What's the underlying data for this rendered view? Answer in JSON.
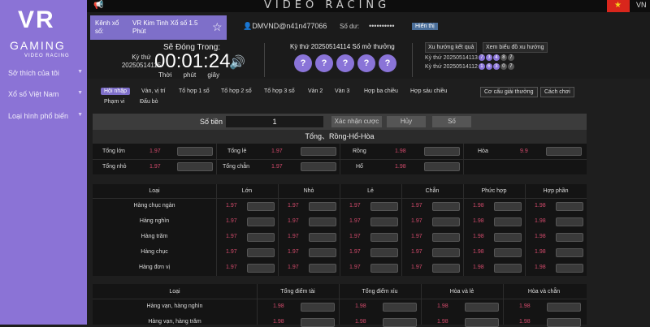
{
  "sidebar": {
    "logo_top": "VR",
    "logo_main": "GAMING",
    "logo_sub": "VIDEO RACING",
    "items": [
      {
        "label": "Sở thích của tôi"
      },
      {
        "label": "Xổ số Việt Nam"
      },
      {
        "label": "Loại hình phổ biến"
      }
    ]
  },
  "topbar": {
    "title": "VIDEO RACING",
    "lang": "VN"
  },
  "header": {
    "kenh_label": "Kênh xổ số:",
    "kenh_value": "VR Kim Tinh Xổ số 1.5 Phút",
    "user": "DMVND@n41n477066",
    "sodu_label": "Số dư:",
    "sodu_value": "••••••••••",
    "hien_thi": "Hiển thị",
    "countdown_title": "Sẽ Đóng Trong:",
    "ky_thu_label": "Kỳ thứ",
    "ky_thu_value": "20250514115",
    "timer": "00:01:24",
    "time_labels": [
      "Thời",
      "phút",
      "giây"
    ],
    "draw_label": "Kỳ thứ 20250514114  Số mở thưởng",
    "balls": [
      "?",
      "?",
      "?",
      "?",
      "?"
    ],
    "btn_trend": "Xu hướng kết quả",
    "btn_chart": "Xem biểu đồ xu hướng",
    "history": [
      {
        "label": "Kỳ thứ 20250514113",
        "nums": [
          "7",
          "3",
          "4",
          "8",
          "7"
        ]
      },
      {
        "label": "Kỳ thứ 20250514112",
        "nums": [
          "1",
          "6",
          "3",
          "0",
          "7"
        ]
      }
    ]
  },
  "tabs": [
    {
      "label": "Hội nhập",
      "active": true
    },
    {
      "label": "Vàn, vị trí"
    },
    {
      "label": "Tổ hợp 1 số"
    },
    {
      "label": "Tổ hợp 2 số"
    },
    {
      "label": "Tổ hợp 3 số"
    },
    {
      "label": "Vàn 2"
    },
    {
      "label": "Vàn 3"
    },
    {
      "label": "Hợp ba chiều"
    },
    {
      "label": "Hợp sáu chiều"
    },
    {
      "label": "Phạm vi"
    },
    {
      "label": "Đấu bò"
    }
  ],
  "tab_right": {
    "structure": "Cơ cấu giải thưởng",
    "howto": "Cách chơi"
  },
  "bet_bar": {
    "amount_label": "Số tiền",
    "amount": "1",
    "confirm": "Xác nhận cược",
    "cancel": "Hủy",
    "count": "Số"
  },
  "section_title": "Tổng、Rồng-Hổ-Hòa",
  "sum_rows": [
    [
      {
        "l": "Tổng lớn",
        "v": "1.97"
      },
      {
        "l": "Tổng lẻ",
        "v": "1.97"
      },
      {
        "l": "Rồng",
        "v": "1.98"
      },
      {
        "l": "Hòa",
        "v": "9.9"
      }
    ],
    [
      {
        "l": "Tổng nhỏ",
        "v": "1.97"
      },
      {
        "l": "Tổng chẵn",
        "v": "1.97"
      },
      {
        "l": "Hổ",
        "v": "1.98"
      }
    ]
  ],
  "pos_table": {
    "headers": [
      "Loại",
      "Lớn",
      "Nhỏ",
      "Lẻ",
      "Chẵn",
      "Phức hợp",
      "Hợp phần"
    ],
    "rows": [
      {
        "name": "Hàng chục ngàn",
        "vals": [
          "1.97",
          "1.97",
          "1.97",
          "1.97",
          "1.98",
          "1.98"
        ]
      },
      {
        "name": "Hàng nghìn",
        "vals": [
          "1.97",
          "1.97",
          "1.97",
          "1.97",
          "1.98",
          "1.98"
        ]
      },
      {
        "name": "Hàng trăm",
        "vals": [
          "1.97",
          "1.97",
          "1.97",
          "1.97",
          "1.98",
          "1.98"
        ]
      },
      {
        "name": "Hàng chục",
        "vals": [
          "1.97",
          "1.97",
          "1.97",
          "1.97",
          "1.98",
          "1.98"
        ]
      },
      {
        "name": "Hàng đơn vị",
        "vals": [
          "1.97",
          "1.97",
          "1.97",
          "1.97",
          "1.98",
          "1.98"
        ]
      }
    ]
  },
  "combo_table": {
    "headers": [
      "Loại",
      "Tổng điểm tài",
      "Tổng điểm xỉu",
      "Hòa và lẻ",
      "Hòa và chẵn"
    ],
    "rows": [
      {
        "name": "Hàng vạn, hàng nghìn",
        "vals": [
          "1.98",
          "1.98",
          "1.98",
          "1.98"
        ]
      },
      {
        "name": "Hàng vạn, hàng trăm",
        "vals": [
          "1.98",
          "1.98",
          "1.98",
          "1.98"
        ]
      }
    ]
  },
  "colors": {
    "accent": "#8b73d6",
    "odds": "#d24a6b"
  }
}
